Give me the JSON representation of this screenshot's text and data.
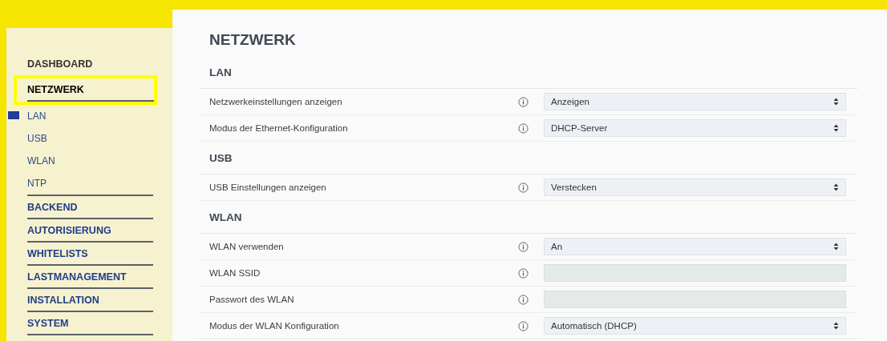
{
  "sidebar": {
    "items": [
      {
        "label": "DASHBOARD",
        "selected": false
      },
      {
        "label": "NETZWERK",
        "selected": true,
        "children": [
          {
            "label": "LAN",
            "selected": true
          },
          {
            "label": "USB",
            "selected": false
          },
          {
            "label": "WLAN",
            "selected": false
          },
          {
            "label": "NTP",
            "selected": false
          }
        ]
      },
      {
        "label": "BACKEND",
        "selected": false
      },
      {
        "label": "AUTORISIERUNG",
        "selected": false
      },
      {
        "label": "WHITELISTS",
        "selected": false
      },
      {
        "label": "LASTMANAGEMENT",
        "selected": false
      },
      {
        "label": "INSTALLATION",
        "selected": false
      },
      {
        "label": "SYSTEM",
        "selected": false
      }
    ]
  },
  "page_title": "NETZWERK",
  "sections": [
    {
      "title": "LAN",
      "rows": [
        {
          "label": "Netzwerkeinstellungen anzeigen",
          "kind": "select",
          "value": "Anzeigen"
        },
        {
          "label": "Modus der Ethernet-Konfiguration",
          "kind": "select",
          "value": "DHCP-Server"
        }
      ]
    },
    {
      "title": "USB",
      "rows": [
        {
          "label": "USB Einstellungen anzeigen",
          "kind": "select",
          "value": "Verstecken"
        }
      ]
    },
    {
      "title": "WLAN",
      "rows": [
        {
          "label": "WLAN verwenden",
          "kind": "select",
          "value": "An"
        },
        {
          "label": "WLAN SSID",
          "kind": "text"
        },
        {
          "label": "Passwort des WLAN",
          "kind": "text"
        },
        {
          "label": "Modus der WLAN Konfiguration",
          "kind": "select",
          "value": "Automatisch (DHCP)"
        }
      ]
    }
  ]
}
